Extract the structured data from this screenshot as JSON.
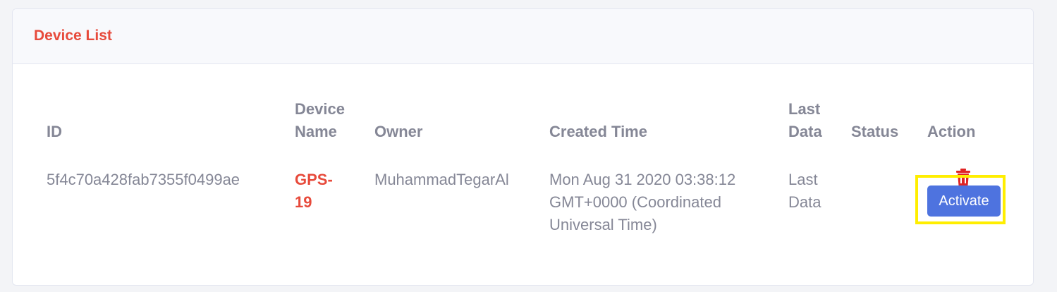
{
  "card": {
    "title": "Device List"
  },
  "table": {
    "headers": {
      "id": "ID",
      "device_name_line1": "Device",
      "device_name_line2": "Name",
      "owner": "Owner",
      "created_time": "Created Time",
      "last_data_line1": "Last",
      "last_data_line2": "Data",
      "status": "Status",
      "action": "Action"
    },
    "rows": [
      {
        "id": "5f4c70a428fab7355f0499ae",
        "device_name_line1": "GPS-",
        "device_name_line2": "19",
        "owner": "MuhammadTegarAl",
        "created_time_line1": "Mon Aug 31 2020 03:38:12",
        "created_time_line2": "GMT+0000 (Coordinated",
        "created_time_line3": "Universal Time)",
        "last_data_line1": "Last",
        "last_data_line2": "Data",
        "status": "",
        "actions": {
          "delete_icon": "trash-icon",
          "activate_label": "Activate"
        }
      }
    ]
  },
  "colors": {
    "accent_red": "#e74a3b",
    "primary_blue": "#4e73df",
    "text_gray": "#858796",
    "highlight_yellow": "#ffee00"
  }
}
